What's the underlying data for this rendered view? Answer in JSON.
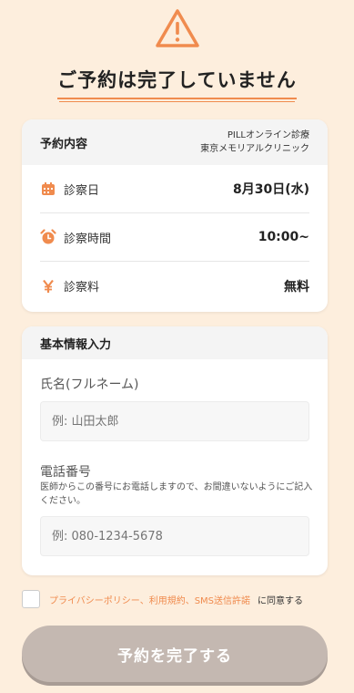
{
  "header": {
    "title": "ご予約は完了していません"
  },
  "summary": {
    "heading": "予約内容",
    "clinic_line1": "PILLオンライン診療",
    "clinic_line2": "東京メモリアルクリニック",
    "rows": [
      {
        "label": "診察日",
        "value": "8月30日(水)",
        "icon": "calendar-icon"
      },
      {
        "label": "診察時間",
        "value": "10:00~",
        "icon": "alarm-clock-icon"
      },
      {
        "label": "診察料",
        "value": "無料",
        "icon": "yen-icon"
      }
    ]
  },
  "form": {
    "heading": "基本情報入力",
    "name_label": "氏名(フルネーム)",
    "name_placeholder": "例: 山田太郎",
    "phone_label": "電話番号",
    "phone_note": "医師からこの番号にお電話しますので、お間違いないようにご記入ください。",
    "phone_placeholder": "例: 080-1234-5678"
  },
  "agreement": {
    "links": "プライバシーポリシー、利用規約、SMS送信許諾",
    "suffix": "に同意する"
  },
  "submit_label": "予約を完了する",
  "colors": {
    "accent": "#f08b4e",
    "background": "#fdeedd",
    "button_disabled": "#c4b8b1"
  }
}
